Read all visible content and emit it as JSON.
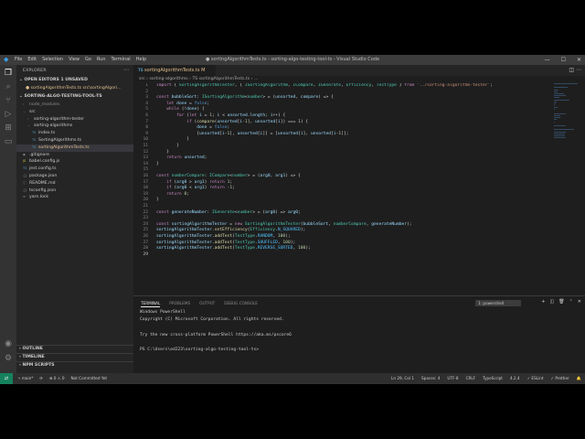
{
  "window": {
    "title": "● sortingAlgorithmTests.ts - sorting-algo-testing-tool-ts - Visual Studio Code",
    "menu": [
      "File",
      "Edit",
      "Selection",
      "View",
      "Go",
      "Run",
      "Terminal",
      "Help"
    ]
  },
  "sidebar": {
    "header": "EXPLORER",
    "open_editors": "OPEN EDITORS   1 UNSAVED",
    "open_file": "● sortingAlgorithmTests.ts  src\\sortingAlgori...",
    "project": "SORTING-ALGO-TESTING-TOOL-TS",
    "tree": [
      {
        "label": "node_modules",
        "icon": "›",
        "indent": 1,
        "cls": "dim"
      },
      {
        "label": "src",
        "icon": "⌄",
        "indent": 1,
        "cls": ""
      },
      {
        "label": "sorting-algorithm-tester",
        "icon": "›",
        "indent": 2,
        "cls": ""
      },
      {
        "label": "sorting-algorithms",
        "icon": "⌄",
        "indent": 2,
        "cls": ""
      },
      {
        "label": "index.ts",
        "icon": "TS",
        "indent": 3,
        "cls": ""
      },
      {
        "label": "SortingAlgorithms.ts",
        "icon": "TS",
        "indent": 3,
        "cls": ""
      },
      {
        "label": "sortingAlgorithmTests.ts",
        "icon": "TS",
        "indent": 3,
        "cls": "mod",
        "active": true
      },
      {
        "label": ".gitignore",
        "icon": "◆",
        "indent": 1,
        "cls": ""
      },
      {
        "label": "babel.config.js",
        "icon": "JS",
        "indent": 1,
        "cls": ""
      },
      {
        "label": "jest.config.ts",
        "icon": "TS",
        "indent": 1,
        "cls": ""
      },
      {
        "label": "package.json",
        "icon": "{}",
        "indent": 1,
        "cls": ""
      },
      {
        "label": "README.md",
        "icon": "ⓘ",
        "indent": 1,
        "cls": ""
      },
      {
        "label": "tsconfig.json",
        "icon": "{}",
        "indent": 1,
        "cls": ""
      },
      {
        "label": "yarn.lock",
        "icon": "≡",
        "indent": 1,
        "cls": ""
      }
    ],
    "bottom": [
      "OUTLINE",
      "TIMELINE",
      "NPM SCRIPTS"
    ]
  },
  "editor": {
    "tab_label": "sortingAlgorithmTests.ts",
    "tab_status": "M",
    "breadcrumb": "src › sorting-algorithms › TS sortingAlgorithmTests.ts › ...",
    "line_numbers": [
      1,
      2,
      3,
      4,
      5,
      6,
      7,
      8,
      9,
      10,
      11,
      12,
      13,
      14,
      15,
      16,
      17,
      18,
      19,
      20,
      21,
      22,
      23,
      24,
      25,
      26,
      27,
      28,
      29
    ],
    "current_line": 29,
    "code_lines": [
      "import { SortingAlgorithmTester, { ISortingAlgorithm, ICompare, IGenerate, Efficiency, TestType } from '../sorting-algorithm-tester';",
      "",
      "const bubbleSort: ISortingAlgorithm<number> = (unsorted, compare) => {",
      "    let done = false;",
      "    while (!done) {",
      "        for (let i = 1; i < unsorted.length; i++) {",
      "            if (compare(unsorted[i-1], unsorted[i]) === 1) {",
      "                done = false;",
      "                [unsorted[i-1], unsorted[i]] = [unsorted[i], unsorted[i-1]];",
      "            }",
      "        }",
      "    }",
      "    return unsorted;",
      "}",
      "",
      "const numberCompare: ICompare<number> = (arg0, arg1) => {",
      "    if (arg0 > arg1) return 1;",
      "    if (arg0 < arg1) return -1;",
      "    return 0;",
      "}",
      "",
      "const generateNumber: IGenerate<number> = (arg0) => arg0;",
      "",
      "const sortingAlgorithmTester = new SortingAlgorithmTester(bubbleSort, numberCompare, generateNumber);",
      "sortingAlgorithmTester.setEfficiency(Efficiency.N_SQUARED);",
      "sortingAlgorithmTester.addTest(TestType.RANDOM, 100);",
      "sortingAlgorithmTester.addTest(TestType.SHUFFLED, 100);",
      "sortingAlgorithmTester.addTest(TestType.REVERSE_SORTED, 100);",
      ""
    ]
  },
  "panel": {
    "tabs": [
      "TERMINAL",
      "PROBLEMS",
      "OUTPUT",
      "DEBUG CONSOLE"
    ],
    "active_tab": "TERMINAL",
    "terminal_select": "1: powershell",
    "terminal_lines": [
      "Windows PowerShell",
      "Copyright (C) Microsoft Corporation. All rights reserved.",
      "",
      "Try the new cross-platform PowerShell https://aka.ms/pscore6",
      "",
      "PS C:\\Users\\ed223\\sorting-algo-testing-tool-ts>"
    ]
  },
  "statusbar": {
    "branch": "main*",
    "sync": "⟳",
    "errors": "⊗ 0  ⚠ 0",
    "git": "Not Committed Yet",
    "right": [
      "Ln 29, Col 1",
      "Spaces: 4",
      "UTF-8",
      "CRLF",
      "TypeScript",
      "4.2.4",
      "✓ ESLint",
      "✓ Prettier"
    ]
  },
  "colors": {
    "keyword": "#c586c0",
    "storage": "#569cd6",
    "type": "#4ec9b0",
    "function": "#dcdcaa",
    "variable": "#9cdcfe",
    "number": "#b5cea8",
    "string": "#ce9178"
  }
}
